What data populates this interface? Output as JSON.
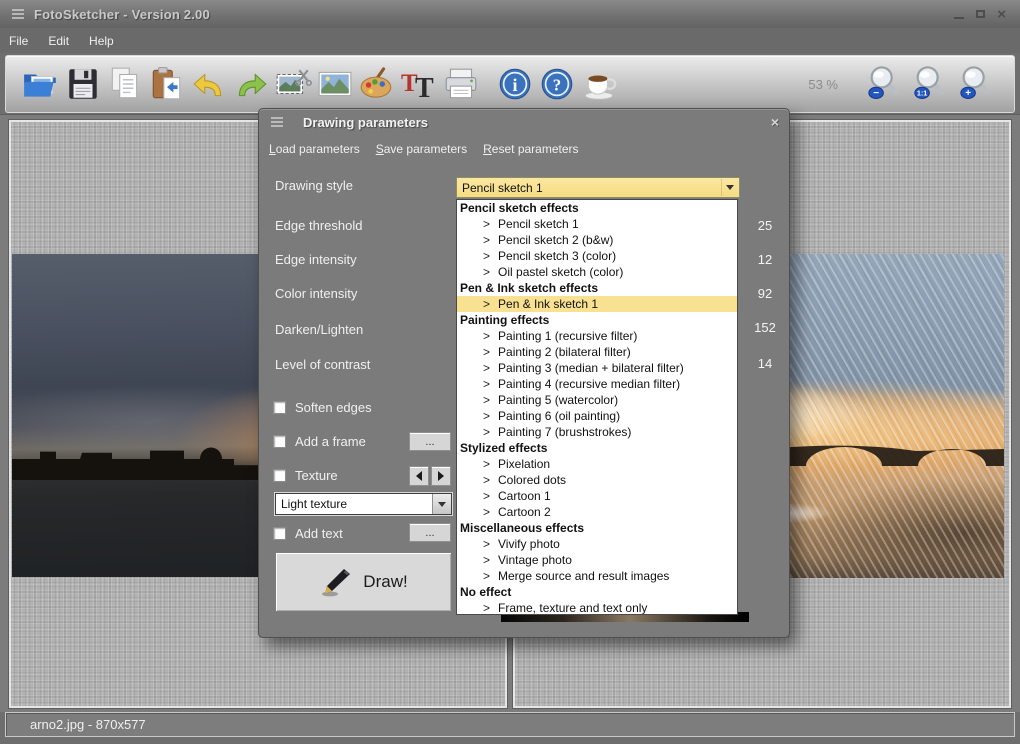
{
  "window": {
    "title": "FotoSketcher - Version 2.00",
    "menu": [
      "File",
      "Edit",
      "Help"
    ],
    "close_glyph": "×",
    "status_text": "arno2.jpg - 870x577"
  },
  "toolbar": {
    "zoom_level": "53 %",
    "icons": [
      "open-image-folder",
      "save-floppy",
      "copy-pages",
      "paste-clipboard",
      "undo-arrow",
      "redo-arrow",
      "crop-image",
      "photo-thumbnail",
      "painter-palette",
      "add-text-TT",
      "printer",
      "info-circle",
      "help-circle",
      "coffee-cup",
      "zoom-out-magnifier",
      "zoom-100-magnifier",
      "zoom-in-magnifier"
    ],
    "zoom_badges": {
      "out": "−",
      "actual": "1:1",
      "in": "+"
    }
  },
  "dialog": {
    "title": "Drawing parameters",
    "close_glyph": "×",
    "menu": [
      {
        "initial": "L",
        "rest": "oad parameters"
      },
      {
        "initial": "S",
        "rest": "ave parameters"
      },
      {
        "initial": "R",
        "rest": "eset parameters"
      }
    ],
    "params": [
      {
        "label": "Drawing style"
      },
      {
        "label": "Edge threshold",
        "value": "25"
      },
      {
        "label": "Edge intensity",
        "value": "12"
      },
      {
        "label": "Color intensity",
        "value": "92"
      },
      {
        "label": "Darken/Lighten",
        "value": "152"
      },
      {
        "label": "Level of contrast",
        "value": "14"
      }
    ],
    "style_combo_value": "Pencil sketch 1",
    "list_marker": ">",
    "style_list": [
      {
        "type": "header",
        "label": "Pencil sketch effects"
      },
      {
        "type": "item",
        "label": "Pencil sketch 1"
      },
      {
        "type": "item",
        "label": "Pencil sketch 2 (b&w)"
      },
      {
        "type": "item",
        "label": "Pencil sketch 3 (color)"
      },
      {
        "type": "item",
        "label": "Oil pastel sketch (color)"
      },
      {
        "type": "header",
        "label": "Pen & Ink sketch effects"
      },
      {
        "type": "item",
        "label": "Pen & Ink sketch 1",
        "selected": true
      },
      {
        "type": "header",
        "label": "Painting effects"
      },
      {
        "type": "item",
        "label": "Painting 1 (recursive filter)"
      },
      {
        "type": "item",
        "label": "Painting 2 (bilateral filter)"
      },
      {
        "type": "item",
        "label": "Painting 3 (median + bilateral filter)"
      },
      {
        "type": "item",
        "label": "Painting 4 (recursive median filter)"
      },
      {
        "type": "item",
        "label": "Painting 5 (watercolor)"
      },
      {
        "type": "item",
        "label": "Painting 6 (oil painting)"
      },
      {
        "type": "item",
        "label": "Painting 7 (brushstrokes)"
      },
      {
        "type": "header",
        "label": "Stylized effects"
      },
      {
        "type": "item",
        "label": "Pixelation"
      },
      {
        "type": "item",
        "label": "Colored dots"
      },
      {
        "type": "item",
        "label": "Cartoon 1"
      },
      {
        "type": "item",
        "label": "Cartoon 2"
      },
      {
        "type": "header",
        "label": "Miscellaneous effects"
      },
      {
        "type": "item",
        "label": "Vivify photo"
      },
      {
        "type": "item",
        "label": "Vintage photo"
      },
      {
        "type": "item",
        "label": "Merge source and result images"
      },
      {
        "type": "header",
        "label": "No effect"
      },
      {
        "type": "item",
        "label": "Frame, texture and text only"
      }
    ],
    "checkboxes": [
      {
        "label": "Soften edges",
        "checked": false
      },
      {
        "label": "Add a frame",
        "checked": false,
        "button": "..."
      },
      {
        "label": "Texture",
        "checked": false
      },
      {
        "label": "Add text",
        "checked": false,
        "button": "..."
      }
    ],
    "texture_combo_value": "Light texture",
    "draw_button_label": "Draw!"
  },
  "colors": {
    "selection_yellow": "#f8e191",
    "dialog_bg": "#7b7b7b",
    "icon_blue": "#3a72bd"
  }
}
